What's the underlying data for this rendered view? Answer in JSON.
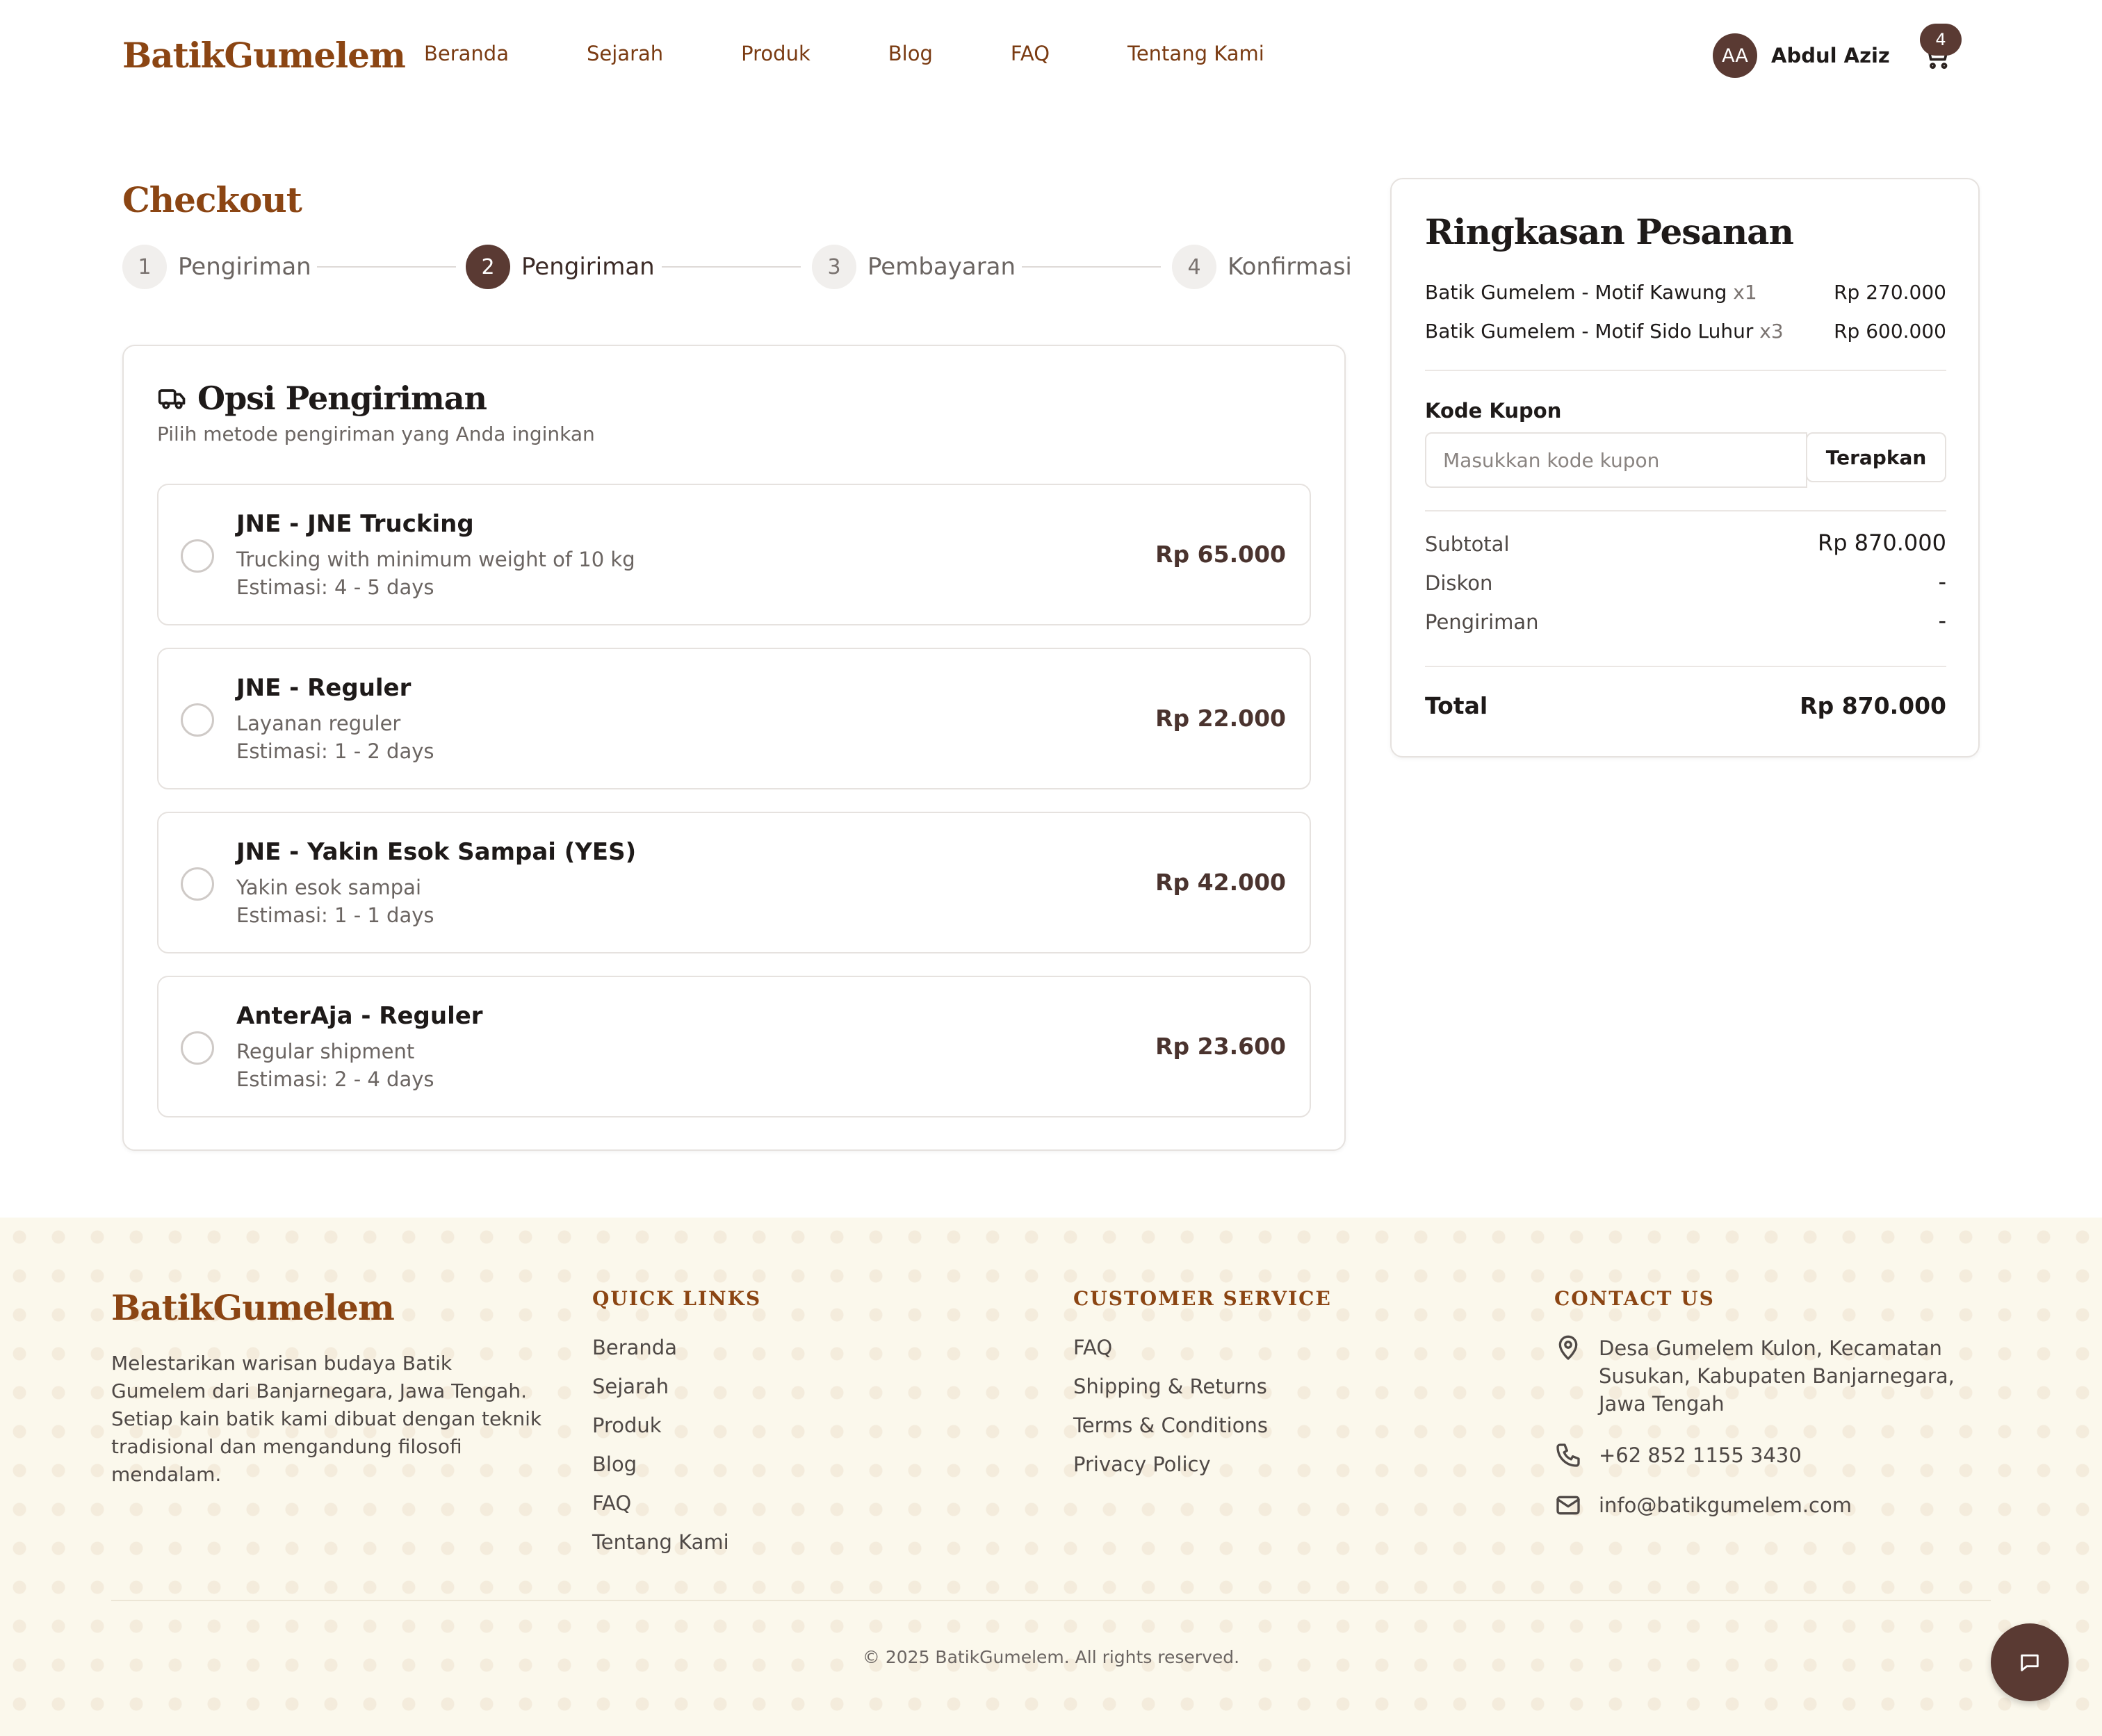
{
  "header": {
    "logo": "BatikGumelem",
    "nav": [
      "Beranda",
      "Sejarah",
      "Produk",
      "Blog",
      "FAQ",
      "Tentang Kami"
    ],
    "user_initials": "AA",
    "user_name": "Abdul Aziz",
    "cart_count": "4"
  },
  "checkout": {
    "title": "Checkout",
    "steps": [
      {
        "num": "1",
        "label": "Pengiriman"
      },
      {
        "num": "2",
        "label": "Pengiriman"
      },
      {
        "num": "3",
        "label": "Pembayaran"
      },
      {
        "num": "4",
        "label": "Konfirmasi"
      }
    ],
    "active_step": 2
  },
  "shipping": {
    "title": "Opsi Pengiriman",
    "subtitle": "Pilih metode pengiriman yang Anda inginkan",
    "options": [
      {
        "name": "JNE - JNE Trucking",
        "desc": "Trucking with minimum weight of 10 kg",
        "estimate": "Estimasi: 4 - 5 days",
        "price": "Rp 65.000"
      },
      {
        "name": "JNE - Reguler",
        "desc": "Layanan reguler",
        "estimate": "Estimasi: 1 - 2 days",
        "price": "Rp 22.000"
      },
      {
        "name": "JNE - Yakin Esok Sampai (YES)",
        "desc": "Yakin esok sampai",
        "estimate": "Estimasi: 1 - 1 days",
        "price": "Rp 42.000"
      },
      {
        "name": "AnterAja - Reguler",
        "desc": "Regular shipment",
        "estimate": "Estimasi: 2 - 4 days",
        "price": "Rp 23.600"
      }
    ]
  },
  "summary": {
    "title": "Ringkasan Pesanan",
    "items": [
      {
        "name": "Batik Gumelem - Motif Kawung",
        "qty": "x1",
        "price": "Rp 270.000"
      },
      {
        "name": "Batik Gumelem - Motif Sido Luhur",
        "qty": "x3",
        "price": "Rp 600.000"
      }
    ],
    "coupon_label": "Kode Kupon",
    "coupon_placeholder": "Masukkan kode kupon",
    "coupon_button": "Terapkan",
    "subtotal_label": "Subtotal",
    "subtotal_value": "Rp 870.000",
    "discount_label": "Diskon",
    "discount_value": "-",
    "shipping_label": "Pengiriman",
    "shipping_value": "-",
    "total_label": "Total",
    "total_value": "Rp 870.000"
  },
  "footer": {
    "logo": "BatikGumelem",
    "description": "Melestarikan warisan budaya Batik Gumelem dari Banjarnegara, Jawa Tengah. Setiap kain batik kami dibuat dengan teknik tradisional dan mengandung filosofi mendalam.",
    "quick_links_title": "QUICK LINKS",
    "quick_links": [
      "Beranda",
      "Sejarah",
      "Produk",
      "Blog",
      "FAQ",
      "Tentang Kami"
    ],
    "service_title": "CUSTOMER SERVICE",
    "service_links": [
      "FAQ",
      "Shipping & Returns",
      "Terms & Conditions",
      "Privacy Policy"
    ],
    "contact_title": "CONTACT US",
    "address": "Desa Gumelem Kulon, Kecamatan Susukan, Kabupaten Banjarnegara, Jawa Tengah",
    "phone": "+62 852 1155 3430",
    "email": "info@batikgumelem.com",
    "copyright": "© 2025 BatikGumelem. All rights reserved."
  },
  "colors": {
    "brand": "#8b4513",
    "dark_accent": "#5a3a33",
    "footer_bg": "#fbf8ec"
  },
  "icons": {
    "shipping": "truck-icon",
    "cart": "cart-icon",
    "address": "map-pin-icon",
    "phone": "phone-icon",
    "email": "mail-icon",
    "chat": "chat-icon"
  }
}
